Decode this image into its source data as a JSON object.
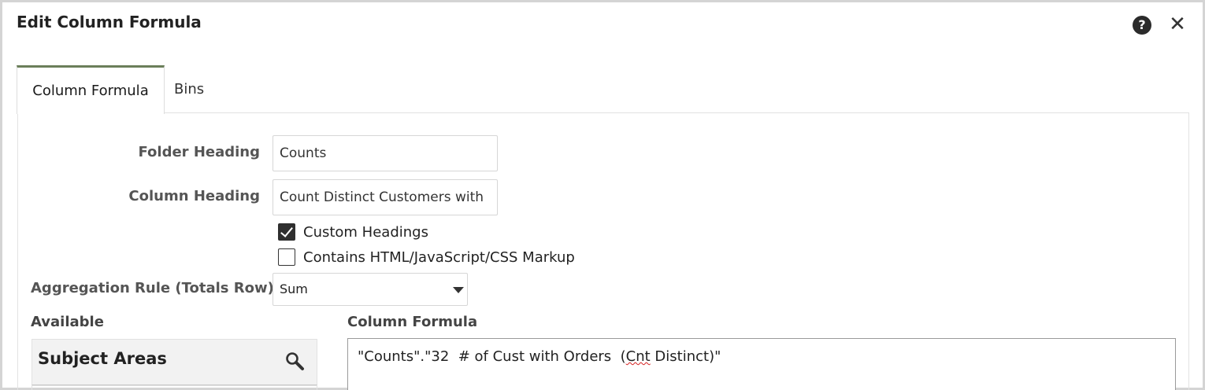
{
  "dialog": {
    "title": "Edit Column Formula",
    "help_glyph": "?",
    "close_glyph": "✕"
  },
  "tabs": [
    {
      "label": "Column Formula",
      "active": true
    },
    {
      "label": "Bins",
      "active": false
    }
  ],
  "form": {
    "folder_heading_label": "Folder Heading",
    "folder_heading_value": "Counts",
    "column_heading_label": "Column Heading",
    "column_heading_value": "Count Distinct Customers with",
    "custom_headings_label": "Custom Headings",
    "custom_headings_checked": true,
    "contains_markup_label": "Contains HTML/JavaScript/CSS Markup",
    "contains_markup_checked": false,
    "aggregation_label": "Aggregation Rule (Totals Row)",
    "aggregation_value": "Sum"
  },
  "available": {
    "label": "Available",
    "subject_areas_title": "Subject Areas"
  },
  "formula": {
    "label": "Column Formula",
    "text_before": "\"Counts\".\"32  # of Cust with Orders  (",
    "text_misspelled": "Cnt",
    "text_after": " Distinct)\""
  },
  "colors": {
    "active_tab_accent": "#6b7f5a",
    "spellcheck_underline": "#d62020"
  }
}
